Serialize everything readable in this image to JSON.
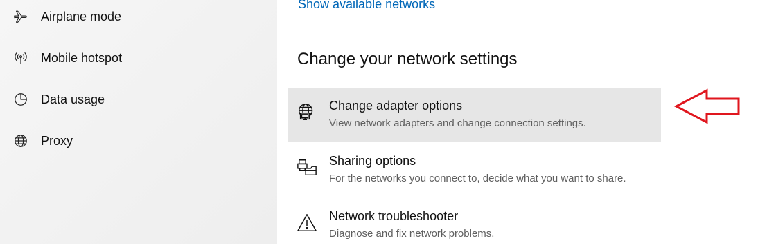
{
  "sidebar": {
    "items": [
      {
        "label": "Airplane mode",
        "icon": "airplane-icon"
      },
      {
        "label": "Mobile hotspot",
        "icon": "hotspot-icon"
      },
      {
        "label": "Data usage",
        "icon": "data-usage-icon"
      },
      {
        "label": "Proxy",
        "icon": "globe-icon"
      }
    ]
  },
  "main": {
    "show_networks_link": "Show available networks",
    "section_heading": "Change your network settings",
    "options": [
      {
        "title": "Change adapter options",
        "description": "View network adapters and change connection settings.",
        "icon": "adapter-icon"
      },
      {
        "title": "Sharing options",
        "description": "For the networks you connect to, decide what you want to share.",
        "icon": "sharing-icon"
      },
      {
        "title": "Network troubleshooter",
        "description": "Diagnose and fix network problems.",
        "icon": "warning-icon"
      }
    ]
  },
  "colors": {
    "link": "#0067b8",
    "highlight": "#e6e6e6",
    "annotation_arrow": "#e0161e"
  }
}
